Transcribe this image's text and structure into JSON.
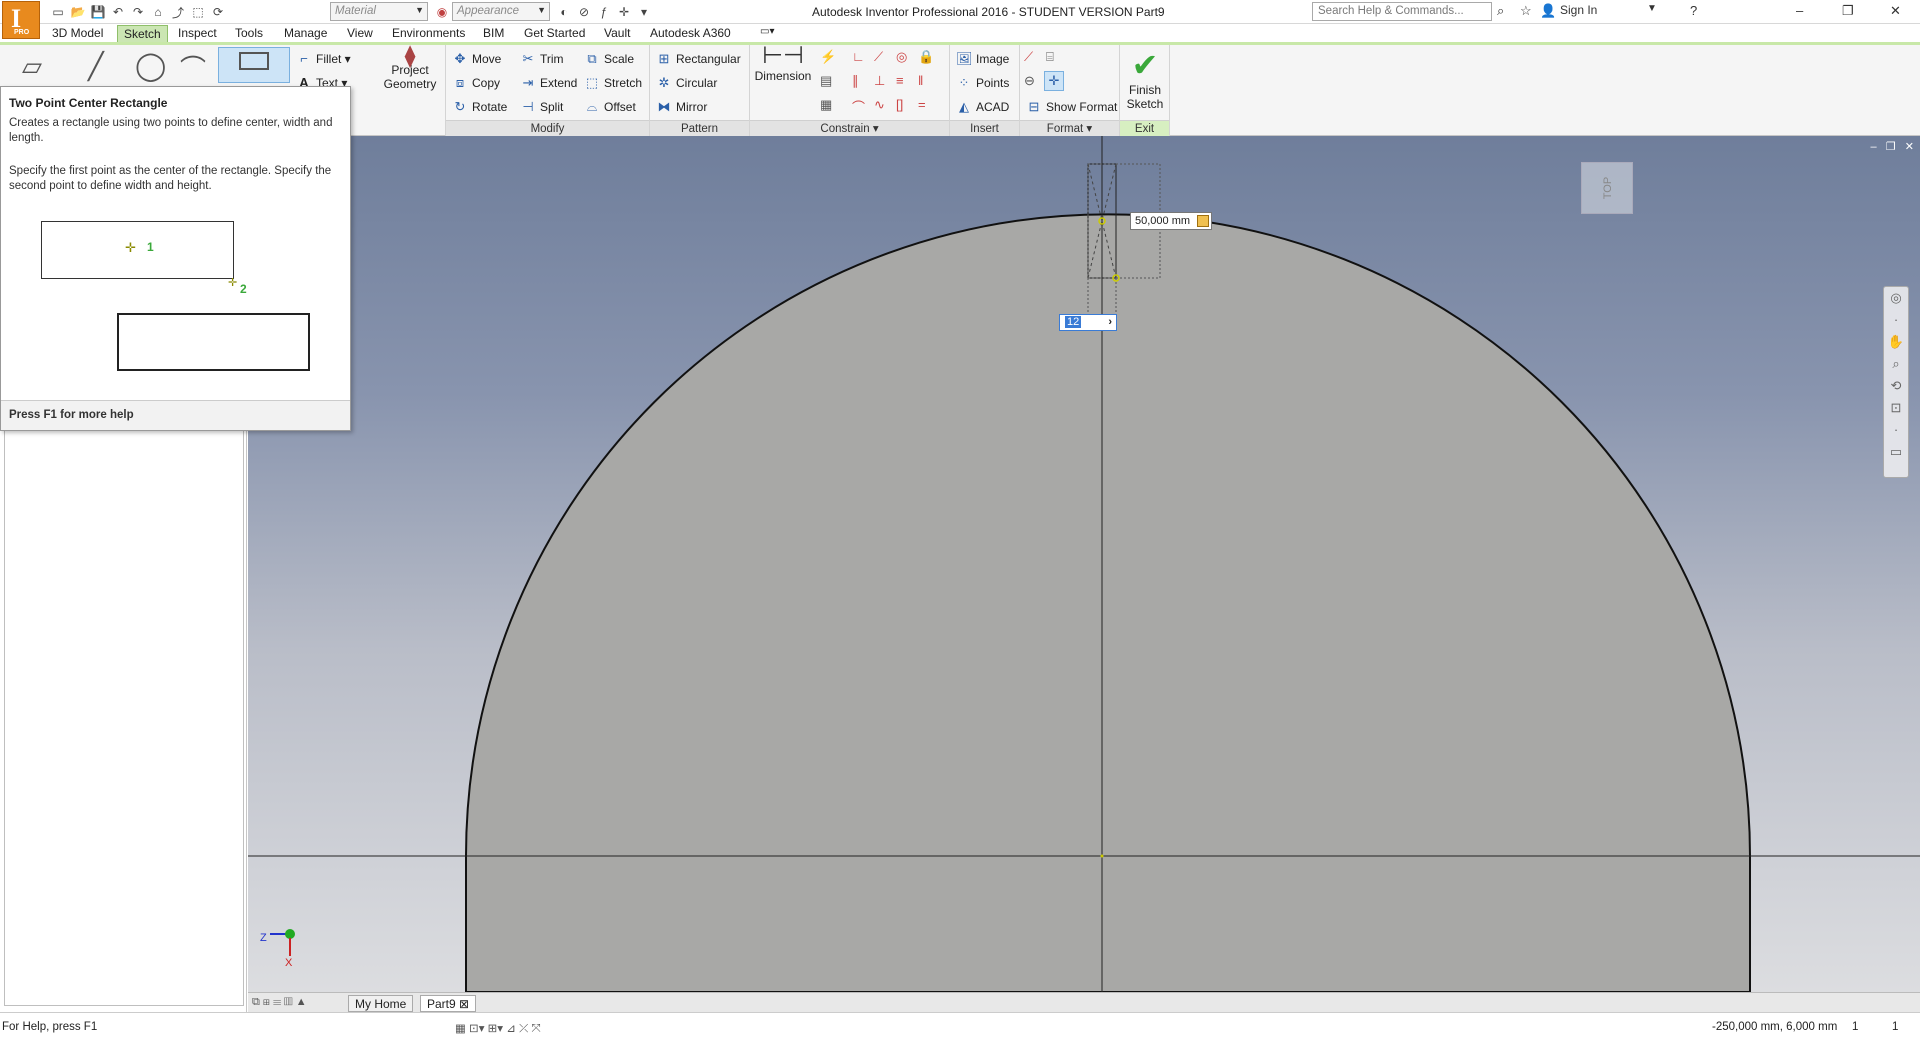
{
  "app": {
    "window_title": "Autodesk Inventor Professional 2016 - STUDENT VERSION    Part9",
    "logo_letter": "I",
    "logo_badge": "PRO",
    "material_placeholder": "Material",
    "appearance_placeholder": "Appearance",
    "search_placeholder": "Search Help & Commands...",
    "sign_in": "Sign In"
  },
  "tabs": [
    "3D Model",
    "Sketch",
    "Inspect",
    "Tools",
    "Manage",
    "View",
    "Environments",
    "BIM",
    "Get Started",
    "Vault",
    "Autodesk A360"
  ],
  "active_tab": "Sketch",
  "ribbon": {
    "create": {
      "fillet": "Fillet",
      "text": "Text"
    },
    "project_geometry": [
      "Project",
      "Geometry"
    ],
    "modify": {
      "label": "Modify",
      "items": [
        "Move",
        "Trim",
        "Scale",
        "Copy",
        "Extend",
        "Stretch",
        "Rotate",
        "Split",
        "Offset"
      ]
    },
    "pattern": {
      "label": "Pattern",
      "items": [
        "Rectangular",
        "Circular",
        "Mirror"
      ]
    },
    "constrain": {
      "label": "Constrain",
      "dimension": "Dimension"
    },
    "insert": {
      "label": "Insert",
      "items": [
        "Image",
        "Points",
        "ACAD"
      ]
    },
    "format": {
      "label": "Format",
      "show_format": "Show Format"
    },
    "exit": {
      "label": "Exit",
      "finish": [
        "Finish",
        "Sketch"
      ]
    }
  },
  "tooltip": {
    "title": "Two Point Center Rectangle",
    "desc": "Creates a rectangle using two points to define center, width and length.",
    "desc2": "Specify the first point as the center of the rectangle. Specify the second point to define width and height.",
    "point1": "1",
    "point2": "2",
    "footer": "Press F1 for more help"
  },
  "canvas": {
    "dimension_value": "50,000 mm",
    "input_value": "12",
    "axis_z": "Z",
    "axis_x": "X",
    "viewcube_label": "TOP"
  },
  "document_tabs": [
    "My Home",
    "Part9"
  ],
  "status": {
    "help": "For Help, press F1",
    "coords": "-250,000 mm, 6,000 mm",
    "count1": "1",
    "count2": "1"
  }
}
